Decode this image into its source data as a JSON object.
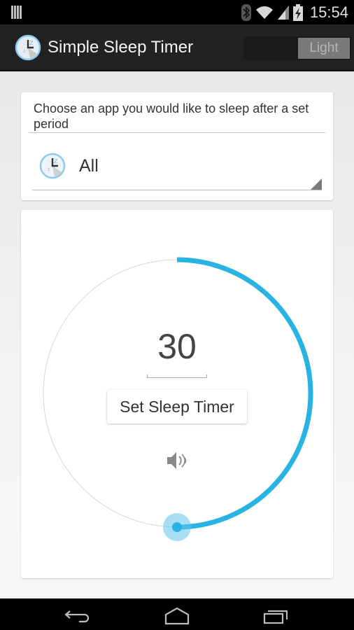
{
  "status_bar": {
    "time": "15:54",
    "icons": [
      "notification-bars-icon",
      "bluetooth-icon",
      "wifi-icon",
      "signal-icon",
      "battery-charging-icon"
    ]
  },
  "action_bar": {
    "title": "Simple Sleep Timer",
    "app_icon": "clock-zzz-icon",
    "theme_toggle_label": "Light"
  },
  "app_chooser": {
    "prompt": "Choose an app you would like to sleep after a set period",
    "selected_app": "All",
    "selected_app_icon": "clock-zzz-icon"
  },
  "timer": {
    "minutes": "30",
    "dial_max_minutes": 60,
    "dial_fraction": 0.5,
    "set_button_label": "Set Sleep Timer",
    "sound_icon": "speaker-icon",
    "accent_color": "#29b3e3"
  },
  "nav_bar": {
    "buttons": [
      "back-icon",
      "home-icon",
      "recents-icon"
    ]
  }
}
